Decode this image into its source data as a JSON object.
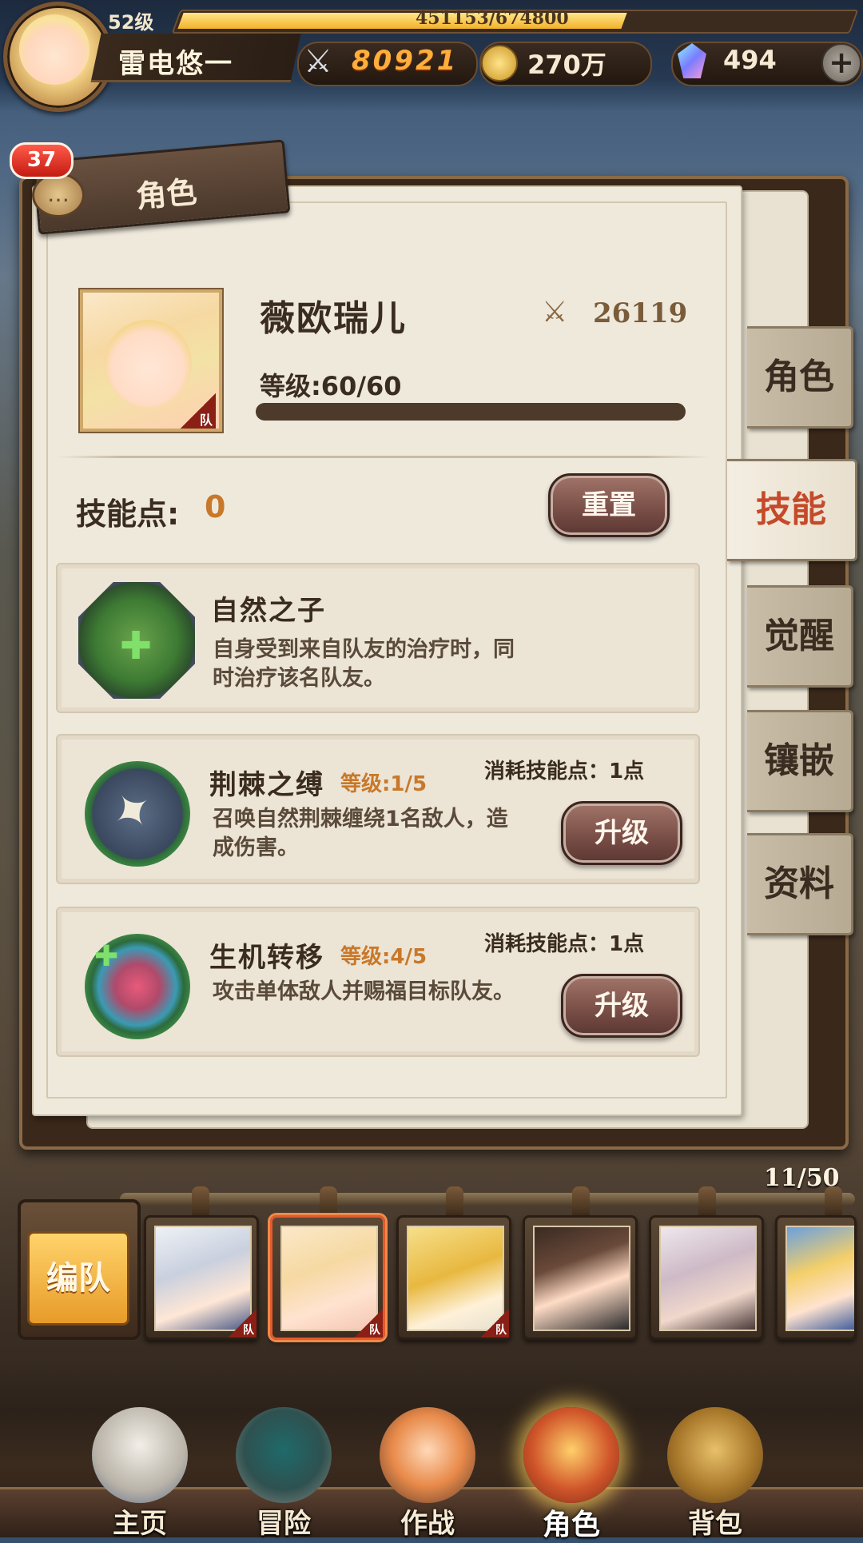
{
  "player": {
    "level_label": "52级",
    "xp_text": "451153/674800",
    "xp_progress": 0.668,
    "name": "雷电悠一"
  },
  "resources": {
    "power": "80921",
    "coins": "270万",
    "gems": "494",
    "add_icon": "plus-icon"
  },
  "panel": {
    "badge_count": "37",
    "title": "角色"
  },
  "hero": {
    "name": "薇欧瑞儿",
    "power": "26119",
    "level_text": "等级:60/60",
    "level_progress": 1.0,
    "team_tag": "队"
  },
  "skills": {
    "points_label": "技能点:",
    "points_value": "0",
    "reset_label": "重置",
    "cost_label": "消耗技能点：1点",
    "upgrade_label": "升级",
    "items": [
      {
        "name": "自然之子",
        "level": "",
        "desc1": "自身受到来自队友的治疗时，同",
        "desc2": "时治疗该名队友。",
        "icon": "nature-child-icon"
      },
      {
        "name": "荆棘之缚",
        "level": "等级:1/5",
        "desc1": "召唤自然荆棘缠绕1名敌人，造",
        "desc2": "成伤害。",
        "icon": "thorn-bind-icon"
      },
      {
        "name": "生机转移",
        "level": "等级:4/5",
        "desc1": "攻击单体敌人并赐福目标队友。",
        "desc2": "",
        "icon": "life-transfer-icon"
      }
    ]
  },
  "side_tabs": [
    "角色",
    "技能",
    "觉醒",
    "镶嵌",
    "资料"
  ],
  "active_side_tab": "技能",
  "roster": {
    "count": "11/50",
    "team_button": "编队",
    "team_tag": "队"
  },
  "nav": {
    "items": [
      "主页",
      "冒险",
      "作战",
      "角色",
      "背包"
    ],
    "active": "角色"
  },
  "colors": {
    "accent_orange": "#c8782a",
    "active_tab_red": "#c44a2a",
    "badge_red": "#c41b12",
    "xp_gold": "#f3b12a"
  }
}
